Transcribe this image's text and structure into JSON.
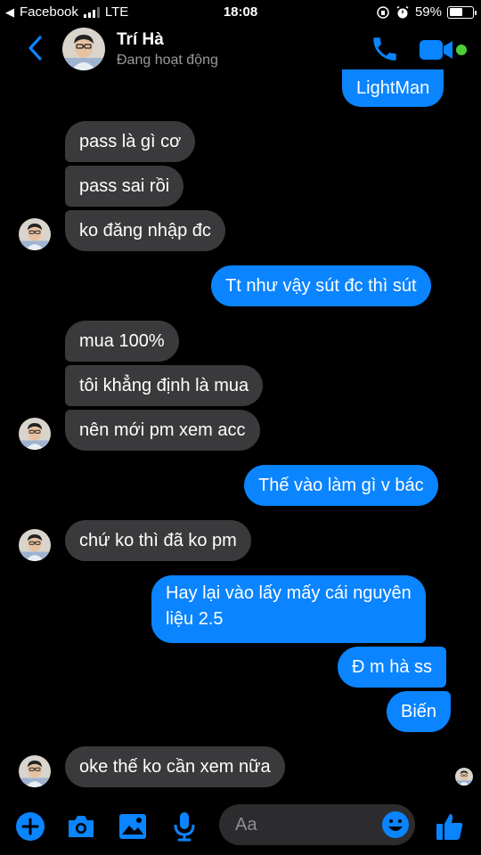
{
  "status_bar": {
    "carrier": "Facebook",
    "network": "LTE",
    "time": "18:08",
    "battery": "59%",
    "battery_level": 0.59
  },
  "header": {
    "name": "Trí Hà",
    "status": "Đang hoạt động"
  },
  "messages": [
    {
      "from": "me",
      "text": "LightMan"
    },
    {
      "from": "them",
      "text": "pass là gì cơ"
    },
    {
      "from": "them",
      "text": "pass sai rồi"
    },
    {
      "from": "them",
      "text": "ko đăng nhập đc"
    },
    {
      "from": "me",
      "text": "Tt như vậy sút đc thì sút"
    },
    {
      "from": "them",
      "text": "mua 100%"
    },
    {
      "from": "them",
      "text": "tôi khẳng định là mua"
    },
    {
      "from": "them",
      "text": "nên mới pm xem acc"
    },
    {
      "from": "me",
      "text": "Thế vào làm gì v bác"
    },
    {
      "from": "them",
      "text": "chứ ko thì đã ko pm"
    },
    {
      "from": "me",
      "text_line1": "Hay lại vào lấy mấy cái nguyên",
      "text_line2": "liệu 2.5"
    },
    {
      "from": "me",
      "text": "Đ m hà ss"
    },
    {
      "from": "me",
      "text": "Biến"
    },
    {
      "from": "them",
      "text": "oke thế ko cần xem nữa"
    }
  ],
  "composer": {
    "placeholder": "Aa"
  },
  "colors": {
    "accent": "#0a84ff",
    "incoming_bubble": "#3a3a3c",
    "background": "#000000",
    "online": "#4cd137"
  },
  "icons": [
    "back-chevron-icon",
    "phone-icon",
    "video-camera-icon",
    "plus-icon",
    "camera-icon",
    "image-icon",
    "microphone-icon",
    "emoji-icon",
    "thumbs-up-icon"
  ]
}
